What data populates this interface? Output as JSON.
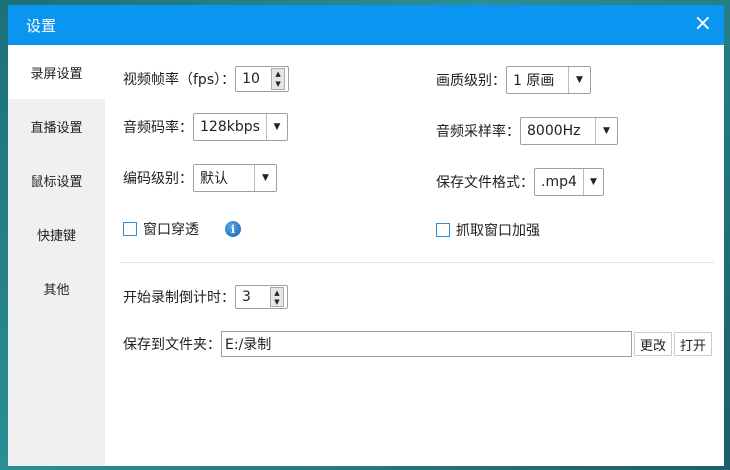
{
  "window": {
    "title": "设置",
    "close_icon": "×"
  },
  "sidebar": {
    "items": [
      {
        "label": "录屏设置"
      },
      {
        "label": "直播设置"
      },
      {
        "label": "鼠标设置"
      },
      {
        "label": "快捷键"
      },
      {
        "label": "其他"
      }
    ]
  },
  "form": {
    "fps": {
      "label": "视频帧率（fps）：",
      "value": "10"
    },
    "quality": {
      "label": "画质级别：",
      "value": "1 原画"
    },
    "audio_bitrate": {
      "label": "音频码率：",
      "value": "128kbps"
    },
    "sample_rate": {
      "label": "音频采样率：",
      "value": "8000Hz"
    },
    "encode_level": {
      "label": "编码级别：",
      "value": "默认"
    },
    "file_format": {
      "label": "保存文件格式：",
      "value": ".mp4"
    },
    "window_through": {
      "label": "窗口穿透",
      "checked": false
    },
    "capture_enhance": {
      "label": "抓取窗口加强",
      "checked": false
    },
    "countdown": {
      "label": "开始录制倒计时：",
      "value": "3"
    },
    "save_folder": {
      "label": "保存到文件夹：",
      "value": "E:/录制",
      "change_label": "更改",
      "open_label": "打开"
    }
  }
}
